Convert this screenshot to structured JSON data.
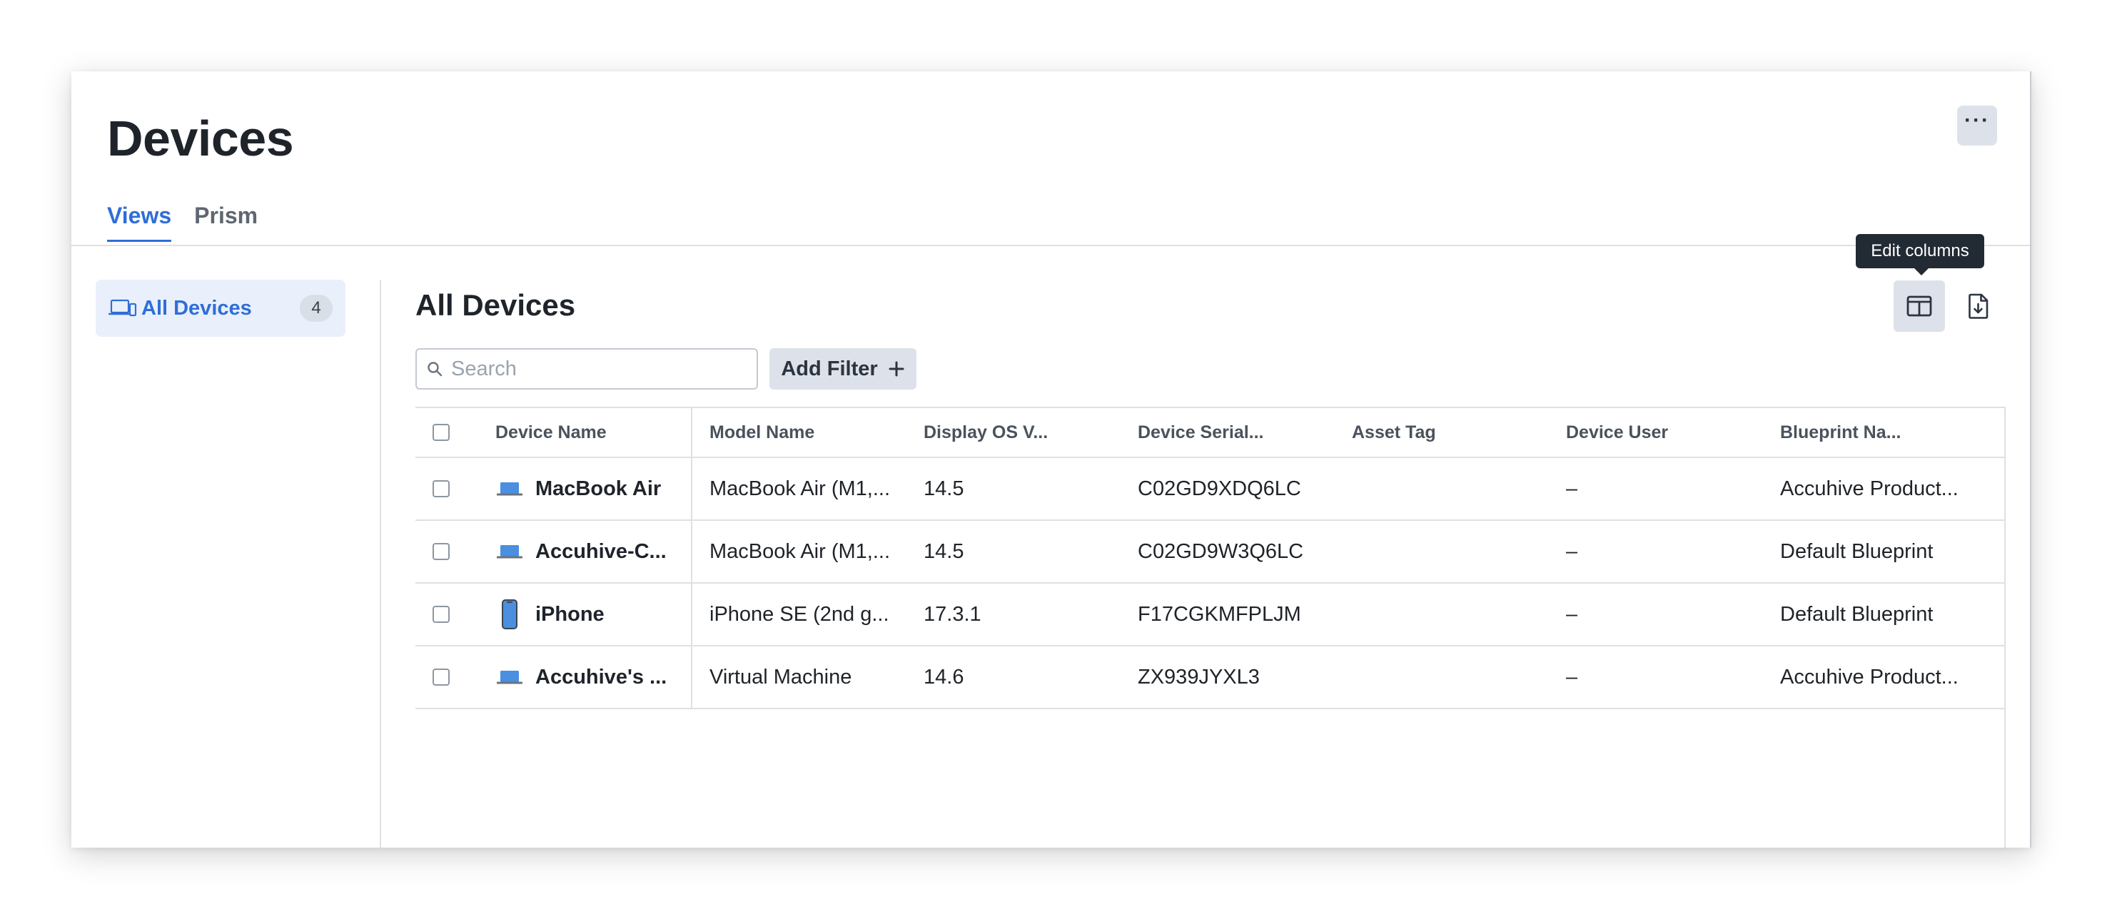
{
  "page": {
    "title": "Devices"
  },
  "header": {
    "more_label": "···"
  },
  "tabs": [
    {
      "label": "Views",
      "active": true
    },
    {
      "label": "Prism",
      "active": false
    }
  ],
  "sidebar": {
    "items": [
      {
        "label": "All Devices",
        "count": "4",
        "icon": "laptop-phone-icon"
      }
    ]
  },
  "main": {
    "title": "All Devices",
    "tooltip": "Edit columns",
    "search": {
      "placeholder": "Search",
      "value": ""
    },
    "add_filter_label": "Add Filter"
  },
  "colors": {
    "accent": "#2f6ed6",
    "tooltip_bg": "#222a33",
    "button_bg": "#dde2ea",
    "device_icon": "#4a8fe0"
  },
  "table": {
    "columns": [
      "Device Name",
      "Model Name",
      "Display OS V...",
      "Device Serial...",
      "Asset Tag",
      "Device User",
      "Blueprint Na..."
    ],
    "rows": [
      {
        "icon": "laptop-icon",
        "device_name": "MacBook Air",
        "model": "MacBook Air (M1,...",
        "os": "14.5",
        "serial": "C02GD9XDQ6LC",
        "asset_tag": "",
        "user": "–",
        "blueprint": "Accuhive Product..."
      },
      {
        "icon": "laptop-icon",
        "device_name": "Accuhive-C...",
        "model": "MacBook Air (M1,...",
        "os": "14.5",
        "serial": "C02GD9W3Q6LC",
        "asset_tag": "",
        "user": "–",
        "blueprint": "Default Blueprint"
      },
      {
        "icon": "phone-icon",
        "device_name": "iPhone",
        "model": "iPhone SE (2nd g...",
        "os": "17.3.1",
        "serial": "F17CGKMFPLJM",
        "asset_tag": "",
        "user": "–",
        "blueprint": "Default Blueprint"
      },
      {
        "icon": "laptop-icon",
        "device_name": "Accuhive's ...",
        "model": "Virtual Machine",
        "os": "14.6",
        "serial": "ZX939JYXL3",
        "asset_tag": "",
        "user": "–",
        "blueprint": "Accuhive Product..."
      }
    ]
  }
}
